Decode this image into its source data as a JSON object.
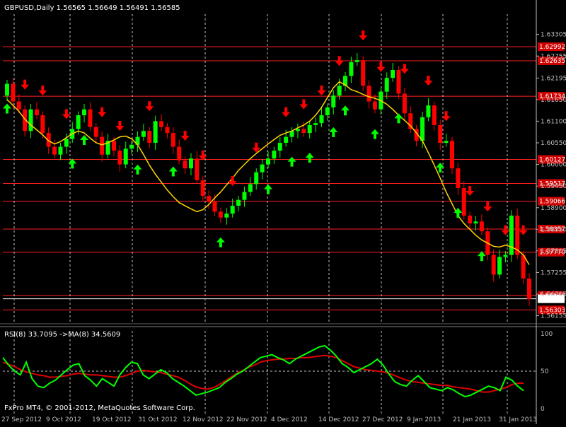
{
  "window": {
    "symbol_header": "GBPUSD,Daily  1.56565 1.56649 1.56491 1.56585",
    "indicator_header": "RSI(8) 33.7095   ->MA(8) 34.5609",
    "copyright": "FxPro MT4, © 2001-2012, MetaQuotes Software Corp."
  },
  "colors": {
    "background": "#000000",
    "bull_candle": "#00ff00",
    "bear_candle": "#ff0000",
    "ma_line": "#ffd400",
    "level_line": "#ff2020",
    "grid": "#c0c0c0",
    "rsi_line": "#00ff00",
    "rsi_ma_line": "#e00000",
    "current_price_tag": "#ffffff"
  },
  "chart_data": [
    {
      "type": "candlestick",
      "title": "GBPUSD,Daily",
      "y_ticks": [
        "1.63305",
        "1.62755",
        "1.62195",
        "1.61650",
        "1.61100",
        "1.60550",
        "1.60000",
        "1.59450",
        "1.58900",
        "1.58350",
        "1.57805",
        "1.57255",
        "1.56705",
        "1.56155"
      ],
      "x_ticks": [
        "27 Sep 2012",
        "9 Oct 2012",
        "19 Oct 2012",
        "31 Oct 2012",
        "12 Nov 2012",
        "22 Nov 2012",
        "4 Dec 2012",
        "14 Dec 2012",
        "27 Dec 2012",
        "9 Jan 2013",
        "21 Jan 2013",
        "31 Jan 2013"
      ],
      "ylim": [
        1.5595,
        1.6382
      ],
      "levels": [
        "1.62992",
        "1.62635",
        "1.61734",
        "1.60127",
        "1.59517",
        "1.59066",
        "1.58357",
        "1.57770",
        "1.56674",
        "1.56585",
        "1.56303"
      ],
      "current_price": "1.56585",
      "close": [
        1.6205,
        1.616,
        1.614,
        1.6085,
        1.614,
        1.6125,
        1.608,
        1.6045,
        1.6025,
        1.6045,
        1.6065,
        1.609,
        1.6125,
        1.614,
        1.6095,
        1.607,
        1.6025,
        1.606,
        1.6035,
        1.6,
        1.604,
        1.605,
        1.607,
        1.6085,
        1.6055,
        1.611,
        1.6095,
        1.608,
        1.6045,
        1.601,
        1.599,
        1.6015,
        1.596,
        1.592,
        1.5905,
        1.588,
        1.5865,
        1.5875,
        1.5895,
        1.591,
        1.593,
        1.595,
        1.598,
        1.6,
        1.6015,
        1.6035,
        1.6055,
        1.607,
        1.6085,
        1.609,
        1.608,
        1.61,
        1.6105,
        1.6125,
        1.6145,
        1.6175,
        1.62,
        1.6225,
        1.626,
        1.6265,
        1.62,
        1.616,
        1.614,
        1.6185,
        1.622,
        1.624,
        1.618,
        1.613,
        1.609,
        1.606,
        1.612,
        1.615,
        1.61,
        1.6055,
        1.606,
        1.599,
        1.594,
        1.587,
        1.585,
        1.5855,
        1.583,
        1.577,
        1.572,
        1.5765,
        1.577,
        1.587,
        1.577,
        1.571,
        1.5658
      ],
      "series": [
        {
          "name": "MA",
          "values": [
            1.6165,
            1.615,
            1.6135,
            1.6115,
            1.61,
            1.6088,
            1.6075,
            1.606,
            1.6052,
            1.6058,
            1.6068,
            1.6078,
            1.6085,
            1.608,
            1.6067,
            1.6055,
            1.605,
            1.6055,
            1.6062,
            1.607,
            1.6072,
            1.6065,
            1.605,
            1.6025,
            1.5998,
            1.5975,
            1.5955,
            1.5935,
            1.5918,
            1.5903,
            1.5895,
            1.5887,
            1.588,
            1.5885,
            1.5898,
            1.5915,
            1.593,
            1.5948,
            1.5965,
            1.5985,
            1.6,
            1.6015,
            1.6028,
            1.604,
            1.6052,
            1.6063,
            1.6074,
            1.608,
            1.6085,
            1.6093,
            1.61,
            1.611,
            1.6125,
            1.6145,
            1.617,
            1.6195,
            1.621,
            1.6202,
            1.619,
            1.6185,
            1.6178,
            1.6172,
            1.6168,
            1.6162,
            1.6153,
            1.614,
            1.6125,
            1.6112,
            1.6098,
            1.608,
            1.606,
            1.603,
            1.5998,
            1.5965,
            1.593,
            1.59,
            1.587,
            1.585,
            1.5835,
            1.582,
            1.5808,
            1.58,
            1.5792,
            1.579,
            1.5795,
            1.579,
            1.5783,
            1.577,
            1.5745
          ]
        }
      ],
      "up_arrows": [
        0,
        11,
        13,
        22,
        28,
        36,
        44,
        48,
        51,
        55,
        57,
        62,
        66,
        73,
        76,
        80
      ],
      "down_arrows": [
        3,
        6,
        10,
        16,
        19,
        24,
        30,
        33,
        38,
        42,
        47,
        50,
        53,
        56,
        60,
        63,
        67,
        71,
        74,
        78,
        81,
        84,
        87
      ]
    },
    {
      "type": "line",
      "title": "RSI(8)",
      "y_ticks": [
        "100",
        "50",
        "0"
      ],
      "ylim": [
        0,
        100
      ],
      "series": [
        {
          "name": "RSI(8)",
          "values": [
            68,
            58,
            50,
            45,
            62,
            40,
            30,
            28,
            34,
            38,
            45,
            52,
            58,
            60,
            44,
            38,
            30,
            40,
            35,
            30,
            45,
            55,
            62,
            60,
            45,
            40,
            46,
            52,
            48,
            40,
            35,
            30,
            24,
            18,
            20,
            22,
            25,
            28,
            35,
            40,
            46,
            50,
            56,
            62,
            68,
            70,
            72,
            68,
            65,
            60,
            66,
            70,
            74,
            78,
            82,
            84,
            78,
            70,
            60,
            55,
            48,
            52,
            56,
            60,
            66,
            58,
            46,
            36,
            32,
            30,
            38,
            44,
            36,
            28,
            26,
            24,
            28,
            25,
            20,
            16,
            18,
            22,
            26,
            30,
            28,
            24,
            42,
            38,
            30,
            24
          ]
        },
        {
          "name": "MA(8)",
          "values": [
            62,
            59,
            56,
            52,
            49,
            47,
            45,
            44,
            42,
            42,
            43,
            44,
            46,
            47,
            46,
            45,
            45,
            44,
            43,
            42,
            42,
            44,
            47,
            50,
            51,
            50,
            49,
            48,
            46,
            44,
            42,
            38,
            33,
            29,
            27,
            26,
            28,
            32,
            37,
            42,
            47,
            51,
            55,
            58,
            62,
            64,
            65,
            66,
            66,
            67,
            67,
            68,
            68,
            69,
            70,
            71,
            70,
            68,
            64,
            60,
            56,
            54,
            52,
            51,
            50,
            49,
            47,
            44,
            41,
            38,
            36,
            35,
            34,
            33,
            32,
            31,
            31,
            29,
            28,
            27,
            26,
            24,
            22,
            22,
            24,
            26,
            28,
            32,
            34,
            34
          ]
        }
      ]
    }
  ]
}
